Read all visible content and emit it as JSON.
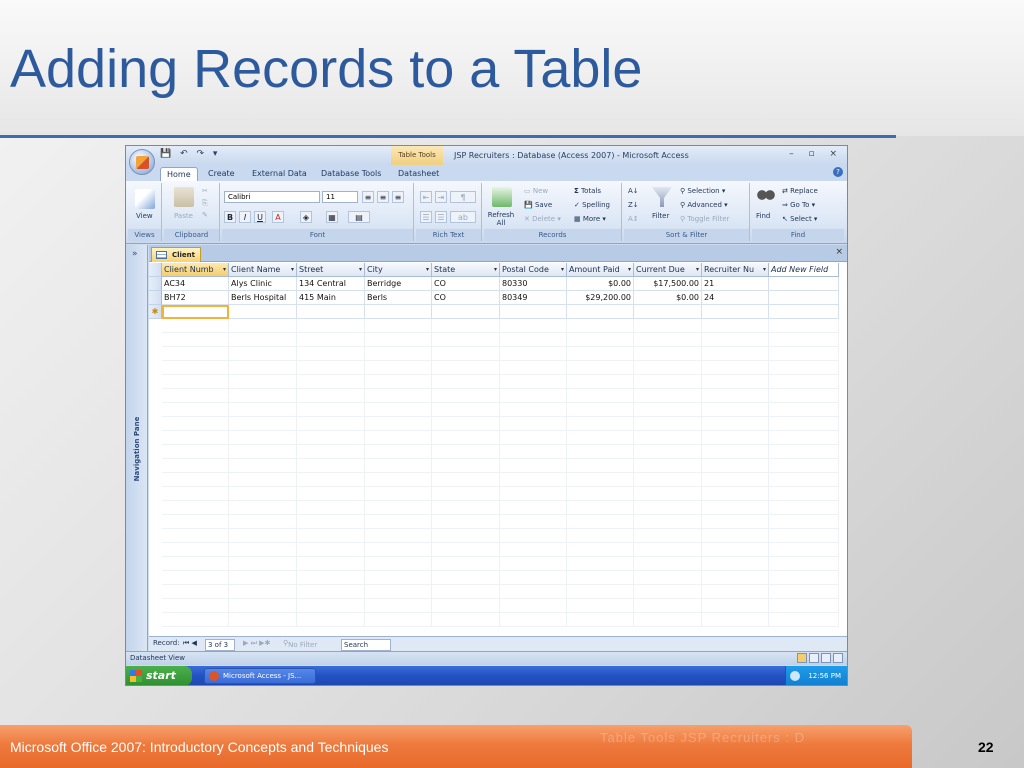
{
  "slide": {
    "title": "Adding Records to a Table",
    "footer": "Microsoft Office 2007: Introductory Concepts and Techniques",
    "footer_ghost": "Table Tools      JSP Recruiters : D",
    "page_number": "22"
  },
  "window": {
    "title": "JSP Recruiters : Database (Access 2007) - Microsoft Access",
    "context_tab": "Table Tools",
    "controls": "– ▫ ×"
  },
  "tabs": [
    "Home",
    "Create",
    "External Data",
    "Database Tools",
    "Datasheet"
  ],
  "ribbon": {
    "views": {
      "view": "View",
      "label": "Views"
    },
    "clipboard": {
      "paste": "Paste",
      "label": "Clipboard"
    },
    "font": {
      "family": "Calibri",
      "size": "11",
      "label": "Font"
    },
    "rich_text": {
      "label": "Rich Text"
    },
    "records": {
      "refresh": "Refresh All",
      "new": "New",
      "save": "Save",
      "delete": "Delete",
      "totals": "Totals",
      "spelling": "Spelling",
      "more": "More",
      "label": "Records"
    },
    "sort_filter": {
      "filter": "Filter",
      "selection": "Selection",
      "advanced": "Advanced",
      "toggle": "Toggle Filter",
      "label": "Sort & Filter"
    },
    "find": {
      "find": "Find",
      "replace": "Replace",
      "goto": "Go To",
      "select": "Select",
      "label": "Find"
    }
  },
  "nav_pane": {
    "label": "Navigation Pane"
  },
  "document_tab": "Client",
  "table": {
    "columns": [
      "Client Numb",
      "Client Name",
      "Street",
      "City",
      "State",
      "Postal Code",
      "Amount Paid",
      "Current Due",
      "Recruiter Nu",
      "Add New Field"
    ],
    "rows": [
      [
        "AC34",
        "Alys Clinic",
        "134 Central",
        "Berridge",
        "CO",
        "80330",
        "$0.00",
        "$17,500.00",
        "21",
        ""
      ],
      [
        "BH72",
        "Berls Hospital",
        "415 Main",
        "Berls",
        "CO",
        "80349",
        "$29,200.00",
        "$0.00",
        "24",
        ""
      ]
    ],
    "new_row_marker": "✱"
  },
  "record_bar": {
    "label": "Record:",
    "position": "3 of 3",
    "filter": "No Filter",
    "search": "Search"
  },
  "status": {
    "text": "Datasheet View"
  },
  "taskbar": {
    "start": "start",
    "item": "Microsoft Access - JS...",
    "time": "12:56 PM"
  }
}
